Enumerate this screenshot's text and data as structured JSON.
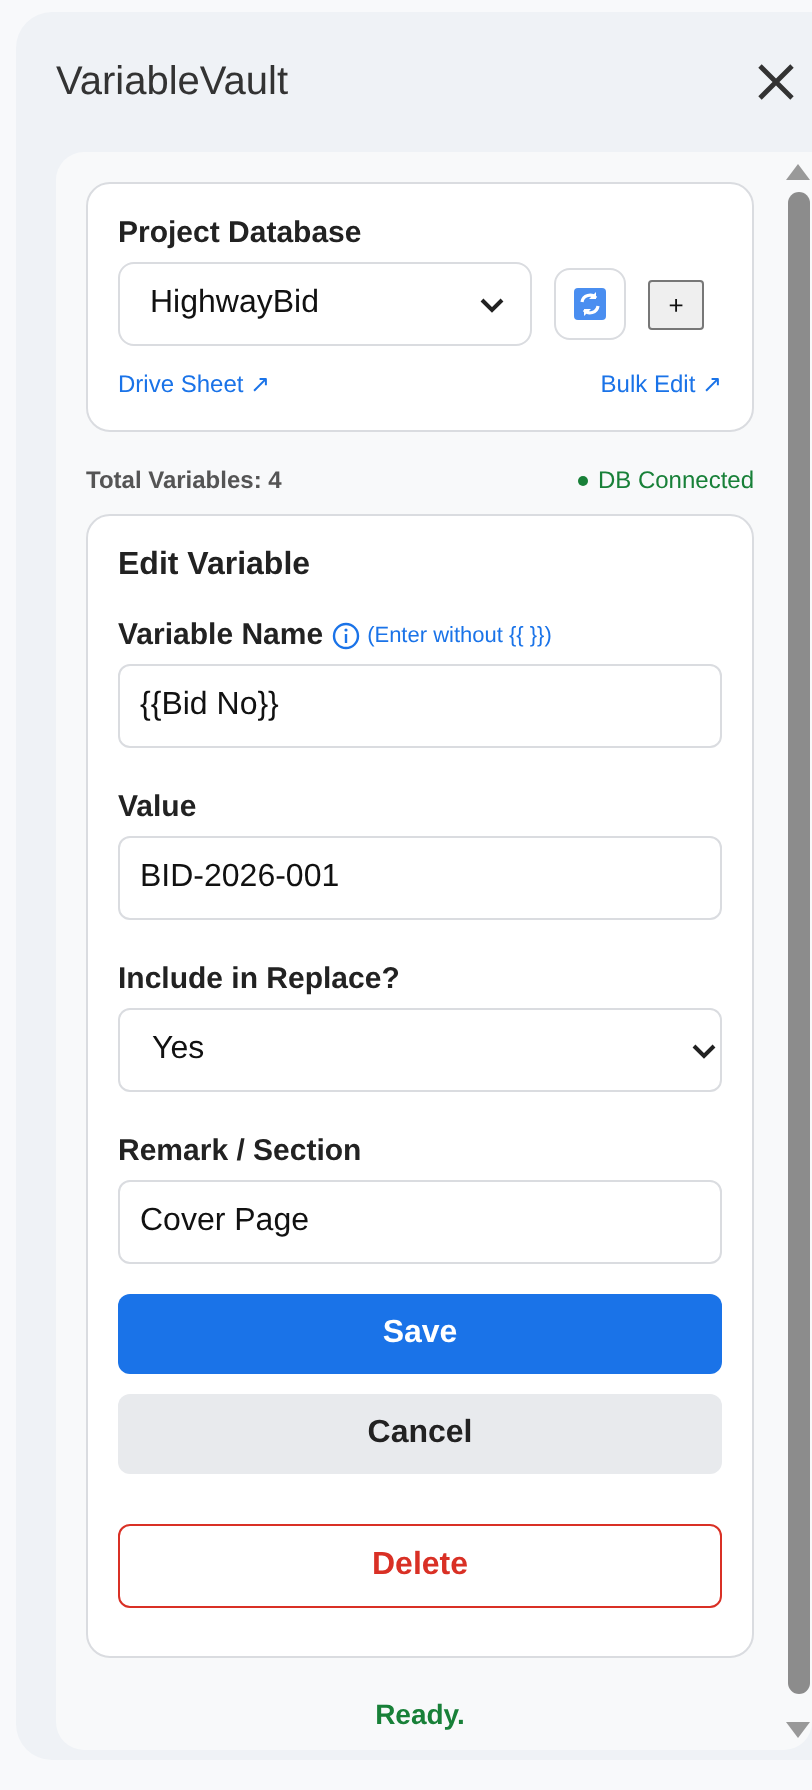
{
  "window": {
    "title": "VariableVault"
  },
  "database": {
    "label": "Project Database",
    "value": "HighwayBid",
    "add_button": "+",
    "links": [
      "Drive Sheet ↗",
      "Bulk Edit ↗"
    ]
  },
  "summary": {
    "total": "Total Variables: 4",
    "status": "DB Connected",
    "connected": true
  },
  "editor": {
    "title": "Edit Variable",
    "fields": [
      {
        "kind": "input",
        "label": "Variable Name",
        "hint": "(Enter without {{ }})",
        "value": "{{Bid No}}"
      },
      {
        "kind": "input",
        "label": "Value",
        "value": "BID-2026-001"
      },
      {
        "kind": "select",
        "label": "Include in Replace?",
        "value": "Yes"
      },
      {
        "kind": "input",
        "label": "Remark / Section",
        "value": "Cover Page"
      }
    ],
    "buttons": [
      {
        "kind": "primary",
        "label": "Save"
      },
      {
        "kind": "secondary",
        "label": "Cancel"
      },
      {
        "kind": "danger",
        "label": "Delete"
      }
    ]
  },
  "status_bar": "Ready."
}
